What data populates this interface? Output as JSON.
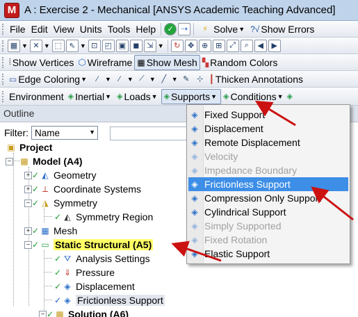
{
  "title": "A : Exercise 2 - Mechanical [ANSYS Academic Teaching Advanced]",
  "app_icon_letter": "M",
  "menubar": {
    "items": [
      "File",
      "Edit",
      "View",
      "Units",
      "Tools",
      "Help"
    ],
    "solve_label": "Solve",
    "show_errors_label": "Show Errors"
  },
  "toolbar3": {
    "show_vertices": "Show Vertices",
    "wireframe": "Wireframe",
    "show_mesh": "Show Mesh",
    "random_colors": "Random Colors"
  },
  "toolbar4": {
    "edge_coloring": "Edge Coloring",
    "thicken_annotations": "Thicken Annotations"
  },
  "toolbar5": {
    "environment": "Environment",
    "inertial": "Inertial",
    "loads": "Loads",
    "supports": "Supports",
    "conditions": "Conditions"
  },
  "outline": {
    "header": "Outline",
    "filter_label": "Filter:",
    "filter_value": "Name",
    "tree": {
      "project": "Project",
      "model": "Model (A4)",
      "geometry": "Geometry",
      "coordinate_systems": "Coordinate Systems",
      "symmetry": "Symmetry",
      "symmetry_region": "Symmetry Region",
      "mesh": "Mesh",
      "static_structural": "Static Structural (A5)",
      "analysis_settings": "Analysis Settings",
      "pressure": "Pressure",
      "displacement": "Displacement",
      "frictionless_support": "Frictionless Support",
      "solution": "Solution (A6)"
    }
  },
  "supports_menu": {
    "items": [
      {
        "label": "Fixed Support",
        "enabled": true,
        "icon": "fixed-support-icon"
      },
      {
        "label": "Displacement",
        "enabled": true,
        "icon": "displacement-icon"
      },
      {
        "label": "Remote Displacement",
        "enabled": true,
        "icon": "remote-displacement-icon"
      },
      {
        "label": "Velocity",
        "enabled": false,
        "icon": "velocity-icon"
      },
      {
        "label": "Impedance Boundary",
        "enabled": false,
        "icon": "impedance-boundary-icon"
      },
      {
        "label": "Frictionless Support",
        "enabled": true,
        "highlighted": true,
        "icon": "frictionless-support-icon"
      },
      {
        "label": "Compression Only Support",
        "enabled": true,
        "icon": "compression-only-support-icon"
      },
      {
        "label": "Cylindrical Support",
        "enabled": true,
        "icon": "cylindrical-support-icon"
      },
      {
        "label": "Simply Supported",
        "enabled": false,
        "icon": "simply-supported-icon"
      },
      {
        "label": "Fixed Rotation",
        "enabled": false,
        "icon": "fixed-rotation-icon"
      },
      {
        "label": "Elastic Support",
        "enabled": true,
        "icon": "elastic-support-icon"
      }
    ]
  },
  "colors": {
    "title_bar": "#bfd3ea",
    "menu_highlight": "#3d8ee6",
    "tree_highlight": "#ffff66",
    "annotation_arrow": "#cc1111",
    "check_green": "#1c9a2e"
  }
}
